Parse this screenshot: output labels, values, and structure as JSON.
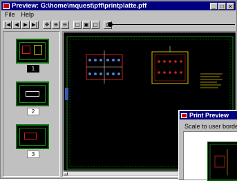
{
  "window": {
    "title": "Preview: G:\\home\\mquest\\pff\\printplatte.pff",
    "controls": {
      "minimize": "_",
      "maximize": "□",
      "close": "×"
    }
  },
  "menu": {
    "file": "File",
    "help": "Help"
  },
  "toolbar": {
    "buttons": [
      {
        "name": "first-page",
        "glyph": "|◀"
      },
      {
        "name": "prev-page",
        "glyph": "◀"
      },
      {
        "name": "next-page",
        "glyph": "▶"
      },
      {
        "name": "last-page",
        "glyph": "▶|"
      },
      {
        "name": "fit-window",
        "glyph": "✥"
      },
      {
        "name": "zoom-in",
        "glyph": "⊕"
      },
      {
        "name": "zoom-out",
        "glyph": "⊖"
      },
      {
        "name": "page-1",
        "glyph": "▢"
      },
      {
        "name": "page-2",
        "glyph": "▣"
      },
      {
        "name": "page-3",
        "glyph": "▢"
      },
      {
        "name": "print",
        "glyph": "⎙"
      }
    ]
  },
  "thumbnails": [
    {
      "label": "1",
      "selected": true
    },
    {
      "label": "2",
      "selected": false
    },
    {
      "label": "3",
      "selected": false
    }
  ],
  "print_dialog": {
    "title": "Print Preview",
    "scale_label": "Scale to user border"
  },
  "colors": {
    "title_bar": "#000080",
    "canvas": "#000000",
    "border_green": "#1a8a1a",
    "component_red": "#d02020",
    "component_yellow": "#d0c000"
  }
}
